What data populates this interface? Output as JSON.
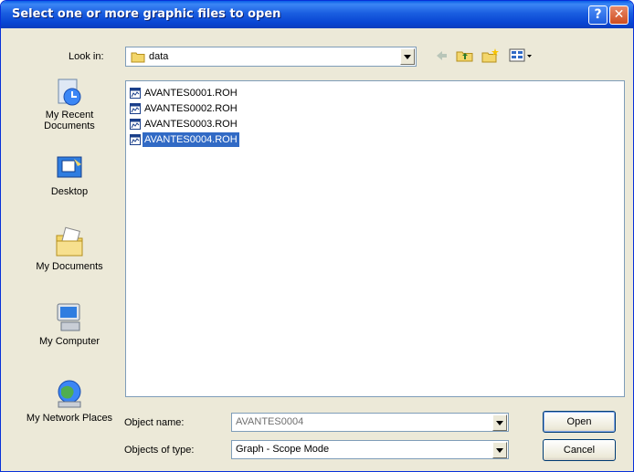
{
  "window": {
    "title": "Select one or more graphic files to open",
    "help_label": "?",
    "close_label": "✕"
  },
  "toolbar": {
    "look_in_label": "Look in:",
    "look_in_value": "data"
  },
  "places": [
    {
      "label": "My Recent Documents",
      "icon": "recent-documents-icon"
    },
    {
      "label": "Desktop",
      "icon": "desktop-icon"
    },
    {
      "label": "My Documents",
      "icon": "my-documents-icon"
    },
    {
      "label": "My Computer",
      "icon": "my-computer-icon"
    },
    {
      "label": "My Network Places",
      "icon": "network-places-icon"
    }
  ],
  "files": [
    {
      "name": "AVANTES0001.ROH",
      "selected": false
    },
    {
      "name": "AVANTES0002.ROH",
      "selected": false
    },
    {
      "name": "AVANTES0003.ROH",
      "selected": false
    },
    {
      "name": "AVANTES0004.ROH",
      "selected": true
    }
  ],
  "form": {
    "object_name_label": "Object name:",
    "object_name_value": "AVANTES0004",
    "objects_type_label": "Objects of type:",
    "objects_type_value": "Graph - Scope Mode"
  },
  "buttons": {
    "open": "Open",
    "cancel": "Cancel"
  },
  "colors": {
    "title_bar": "#0a5fe7",
    "selection": "#316ac5",
    "dialog_bg": "#ece9d8"
  }
}
